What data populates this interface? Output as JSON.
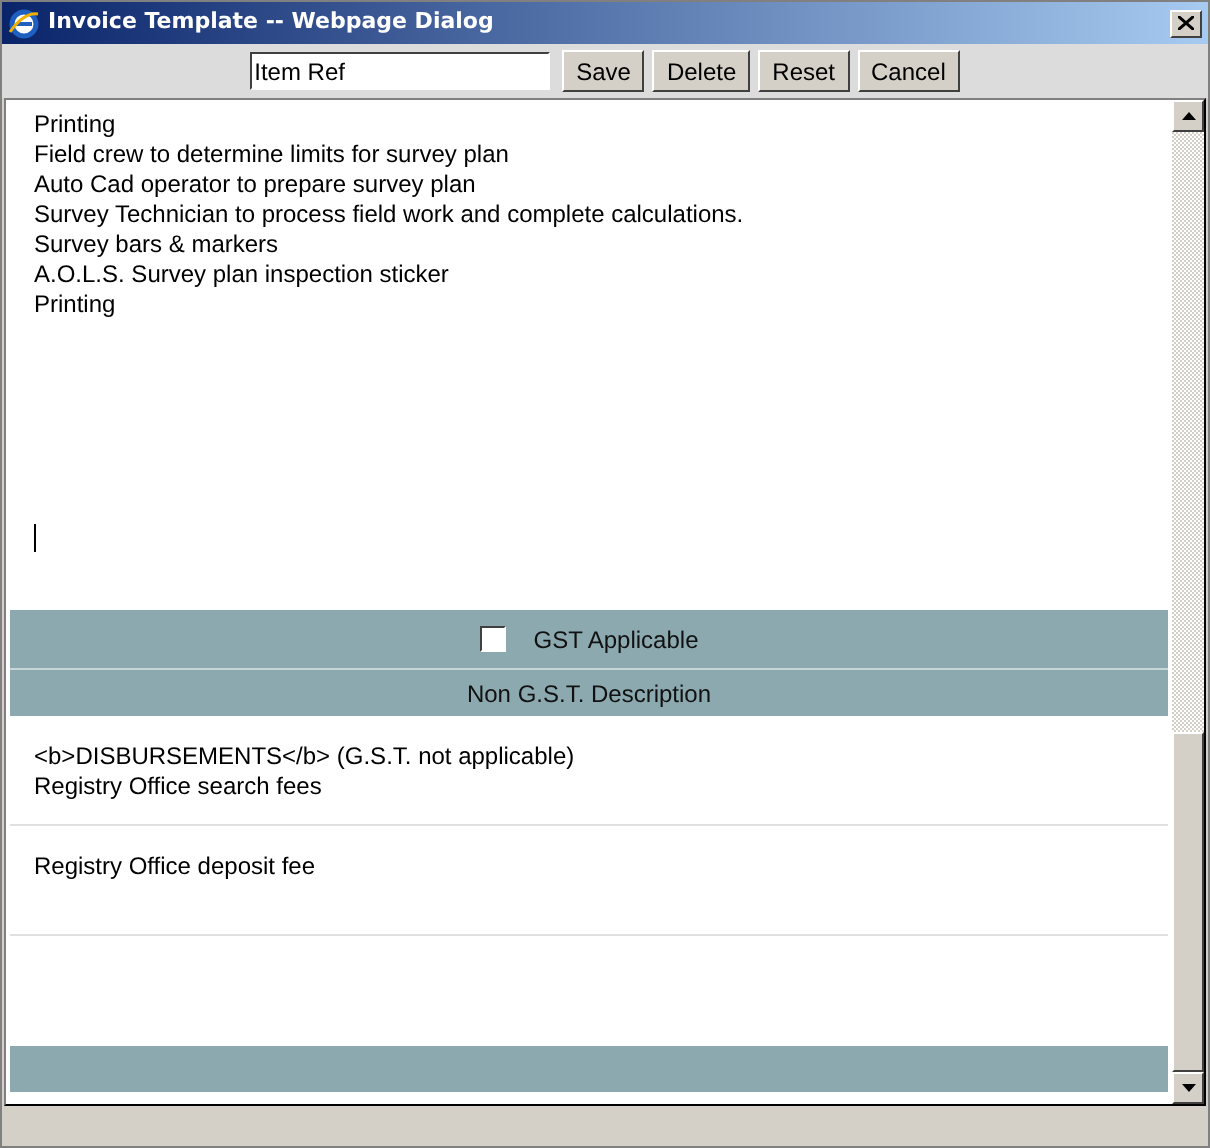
{
  "window": {
    "title": "Invoice Template -- Webpage Dialog"
  },
  "toolbar": {
    "item_ref": {
      "value": "Item Ref"
    },
    "buttons": [
      "Save",
      "Delete",
      "Reset",
      "Cancel"
    ]
  },
  "description_lines": [
    "Printing",
    "Field crew to determine limits for survey plan",
    "Auto Cad operator to prepare survey plan",
    "Survey Technician to process field work and complete calculations.",
    "Survey bars & markers",
    "A.O.L.S. Survey plan inspection sticker",
    "Printing"
  ],
  "gst_applicable": {
    "label": "GST Applicable",
    "checked": false
  },
  "non_gst": {
    "heading": "Non G.S.T. Description",
    "rows": [
      {
        "lines": [
          "<b>DISBURSEMENTS</b> (G.S.T. not applicable)",
          "Registry Office search fees"
        ]
      },
      {
        "lines": [
          "Registry Office deposit fee"
        ]
      }
    ]
  }
}
